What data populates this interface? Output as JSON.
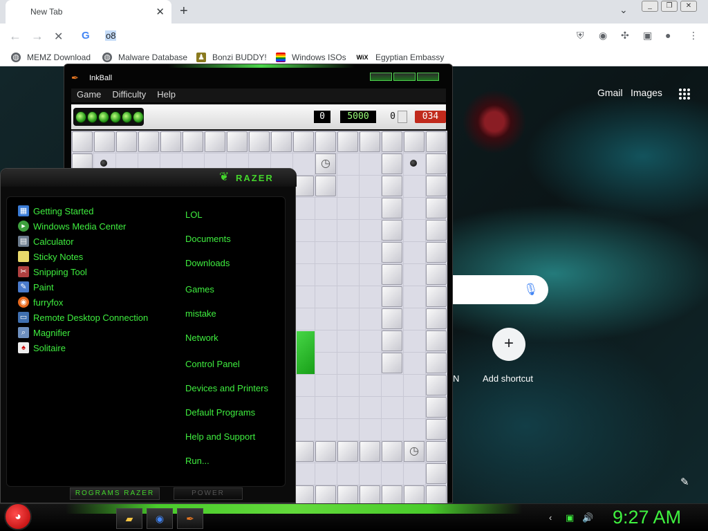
{
  "browser": {
    "tab_title": "New Tab",
    "tab_close": "✕",
    "new_tab": "+",
    "omnibox_text": "o8",
    "bookmarks": [
      {
        "label": "MEMZ Download",
        "icon": "globe-icon"
      },
      {
        "label": "Malware Database",
        "icon": "globe-icon"
      },
      {
        "label": "Bonzi BUDDY!",
        "icon": "bonzi-icon"
      },
      {
        "label": "Windows ISOs",
        "icon": "windows-flag-icon"
      },
      {
        "label": "Egyptian Embassy",
        "icon": "wix-icon"
      }
    ]
  },
  "ntp": {
    "gmail": "Gmail",
    "images": "Images",
    "add_shortcut_label": "Add shortcut",
    "add_shortcut_plus": "+",
    "partial_shortcut_label": "N"
  },
  "inkball": {
    "title": "InkBall",
    "menu": [
      "Game",
      "Difficulty",
      "Help"
    ],
    "score_a": "0",
    "score_b": "5000",
    "score_c": "0",
    "score_d": "034",
    "colors": {
      "ball": "#2b9d1c",
      "timer_bg": "#c12a1c",
      "grid": "#dcdce6"
    }
  },
  "startmenu": {
    "logo": "RAZER",
    "programs": [
      "Getting Started",
      "Windows Media Center",
      "Calculator",
      "Sticky Notes",
      "Snipping Tool",
      "Paint",
      "furryfox",
      "Remote Desktop Connection",
      "Magnifier",
      "Solitaire"
    ],
    "places": [
      "LOL",
      "Documents",
      "Downloads",
      "Games",
      "mistake",
      "Network",
      "Control Panel",
      "Devices and Printers",
      "Default Programs",
      "Help and Support",
      "Run..."
    ],
    "programs_button": "ROGRAMS RAZER",
    "power_button": "POWER",
    "accent": "#44d62c"
  },
  "taskbar": {
    "clock": "9:27 AM"
  }
}
